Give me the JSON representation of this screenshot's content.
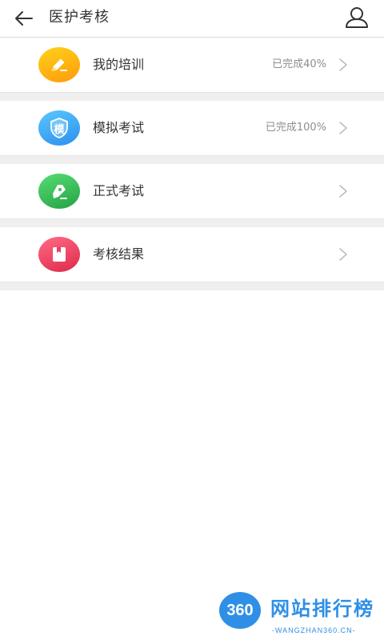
{
  "header": {
    "title": "医护考核"
  },
  "menu": [
    {
      "label": "我的培训",
      "status": "已完成40%",
      "icon": "pencil-icon",
      "color_start": "#ffd21a",
      "color_end": "#ff9f0a"
    },
    {
      "label": "模拟考试",
      "status": "已完成100%",
      "icon": "shield-icon",
      "icon_text": "模",
      "color_start": "#5bc7ff",
      "color_end": "#2c92f0"
    },
    {
      "label": "正式考试",
      "status": "",
      "icon": "pen-nib-icon",
      "color_start": "#56dc73",
      "color_end": "#2aa54a"
    },
    {
      "label": "考核结果",
      "status": "",
      "icon": "book-icon",
      "color_start": "#ff6b84",
      "color_end": "#e02d4e"
    }
  ],
  "watermark": {
    "badge": "360",
    "title": "网站排行榜",
    "subtitle": "-WANGZHAN360.CN-"
  }
}
